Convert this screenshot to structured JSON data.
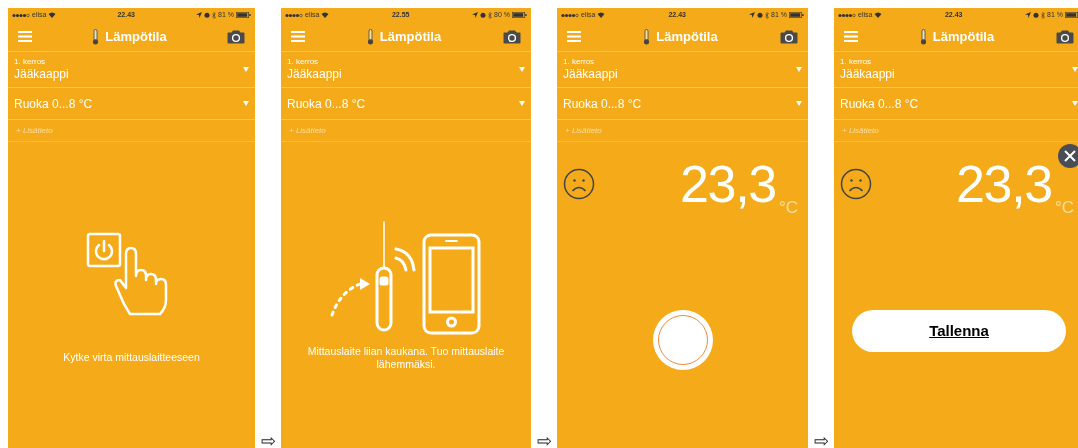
{
  "screens": [
    {
      "kind": "power",
      "status": {
        "carrier": "elisa",
        "time": "22.43",
        "battery": "81 %"
      },
      "title": "Lämpötila",
      "location": {
        "label": "1. kerros",
        "value": "Jääkaappi"
      },
      "category": "Ruoka 0...8 °C",
      "more_info": "+ Lisätieto",
      "message": "Kytke virta mittauslaitteeseen"
    },
    {
      "kind": "distance",
      "status": {
        "carrier": "elisa",
        "time": "22.55",
        "battery": "80 %"
      },
      "title": "Lämpötila",
      "location": {
        "label": "1. kerros",
        "value": "Jääkaappi"
      },
      "category": "Ruoka 0...8 °C",
      "more_info": "+ Lisätieto",
      "message": "Mittauslaite liian kaukana. Tuo mittauslaite lähemmäksi."
    },
    {
      "kind": "reading",
      "status": {
        "carrier": "elisa",
        "time": "22.43",
        "battery": "81 %"
      },
      "title": "Lämpötila",
      "location": {
        "label": "1. kerros",
        "value": "Jääkaappi"
      },
      "category": "Ruoka 0...8 °C",
      "more_info": "+ Lisätieto",
      "reading": {
        "value": "23,3",
        "unit": "°C"
      }
    },
    {
      "kind": "save",
      "status": {
        "carrier": "elisa",
        "time": "22.43",
        "battery": "81 %"
      },
      "title": "Lämpötila",
      "location": {
        "label": "1. kerros",
        "value": "Jääkaappi"
      },
      "category": "Ruoka 0...8 °C",
      "more_info": "+ Lisätieto",
      "reading": {
        "value": "23,3",
        "unit": "°C"
      },
      "save_button": "Tallenna"
    }
  ],
  "arrows": [
    "⇨",
    "⇨",
    "⇨"
  ]
}
